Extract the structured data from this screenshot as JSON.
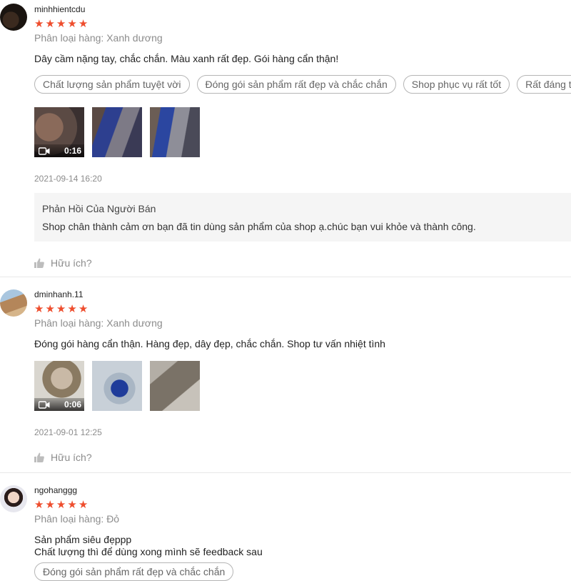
{
  "reviews": [
    {
      "username": "minhhientcdu",
      "rating": 5,
      "variation": "Phân loại hàng: Xanh dương",
      "comment": "Dây cầm nặng tay, chắc chắn. Màu xanh rất đẹp. Gói hàng cẩn thận!",
      "tags": [
        "Chất lượng sản phẩm tuyệt vời",
        "Đóng gói sản phẩm rất đẹp và chắc chắn",
        "Shop phục vụ rất tốt",
        "Rất đáng tiền"
      ],
      "video_duration": "0:16",
      "timestamp": "2021-09-14 16:20",
      "seller_reply": {
        "title": "Phản Hồi Của Người Bán",
        "text": "Shop chân thành cảm ơn bạn đã tin dùng sản phẩm của shop ạ.chúc bạn vui khỏe và thành công."
      },
      "helpful": "Hữu ích?"
    },
    {
      "username": "dminhanh.11",
      "rating": 5,
      "variation": "Phân loại hàng: Xanh dương",
      "comment": "Đóng gói hàng cẩn thận. Hàng đẹp, dây đẹp, chắc chắn. Shop tư vấn nhiệt tình",
      "video_duration": "0:06",
      "timestamp": "2021-09-01 12:25",
      "helpful": "Hữu ích?"
    },
    {
      "username": "ngohanggg",
      "rating": 5,
      "variation": "Phân loại hàng: Đỏ",
      "comment": "Sản phẩm siêu đẹppp\nChất lượng thì để dùng xong mình sẽ feedback sau",
      "tags": [
        "Đóng gói sản phẩm rất đẹp và chắc chắn"
      ]
    }
  ],
  "colors": {
    "star": "#ee4d2d",
    "muted": "#8c8c8c"
  }
}
